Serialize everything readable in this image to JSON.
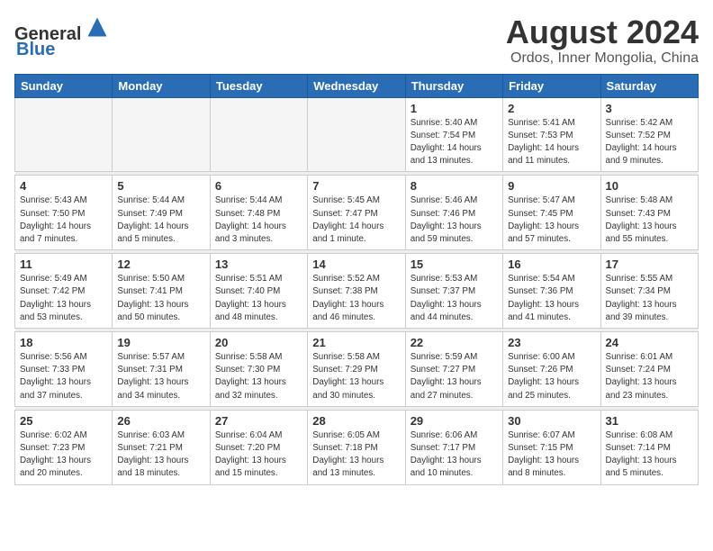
{
  "header": {
    "logo_general": "General",
    "logo_blue": "Blue",
    "month_title": "August 2024",
    "subtitle": "Ordos, Inner Mongolia, China"
  },
  "weekdays": [
    "Sunday",
    "Monday",
    "Tuesday",
    "Wednesday",
    "Thursday",
    "Friday",
    "Saturday"
  ],
  "weeks": [
    [
      {
        "day": "",
        "info": ""
      },
      {
        "day": "",
        "info": ""
      },
      {
        "day": "",
        "info": ""
      },
      {
        "day": "",
        "info": ""
      },
      {
        "day": "1",
        "info": "Sunrise: 5:40 AM\nSunset: 7:54 PM\nDaylight: 14 hours\nand 13 minutes."
      },
      {
        "day": "2",
        "info": "Sunrise: 5:41 AM\nSunset: 7:53 PM\nDaylight: 14 hours\nand 11 minutes."
      },
      {
        "day": "3",
        "info": "Sunrise: 5:42 AM\nSunset: 7:52 PM\nDaylight: 14 hours\nand 9 minutes."
      }
    ],
    [
      {
        "day": "4",
        "info": "Sunrise: 5:43 AM\nSunset: 7:50 PM\nDaylight: 14 hours\nand 7 minutes."
      },
      {
        "day": "5",
        "info": "Sunrise: 5:44 AM\nSunset: 7:49 PM\nDaylight: 14 hours\nand 5 minutes."
      },
      {
        "day": "6",
        "info": "Sunrise: 5:44 AM\nSunset: 7:48 PM\nDaylight: 14 hours\nand 3 minutes."
      },
      {
        "day": "7",
        "info": "Sunrise: 5:45 AM\nSunset: 7:47 PM\nDaylight: 14 hours\nand 1 minute."
      },
      {
        "day": "8",
        "info": "Sunrise: 5:46 AM\nSunset: 7:46 PM\nDaylight: 13 hours\nand 59 minutes."
      },
      {
        "day": "9",
        "info": "Sunrise: 5:47 AM\nSunset: 7:45 PM\nDaylight: 13 hours\nand 57 minutes."
      },
      {
        "day": "10",
        "info": "Sunrise: 5:48 AM\nSunset: 7:43 PM\nDaylight: 13 hours\nand 55 minutes."
      }
    ],
    [
      {
        "day": "11",
        "info": "Sunrise: 5:49 AM\nSunset: 7:42 PM\nDaylight: 13 hours\nand 53 minutes."
      },
      {
        "day": "12",
        "info": "Sunrise: 5:50 AM\nSunset: 7:41 PM\nDaylight: 13 hours\nand 50 minutes."
      },
      {
        "day": "13",
        "info": "Sunrise: 5:51 AM\nSunset: 7:40 PM\nDaylight: 13 hours\nand 48 minutes."
      },
      {
        "day": "14",
        "info": "Sunrise: 5:52 AM\nSunset: 7:38 PM\nDaylight: 13 hours\nand 46 minutes."
      },
      {
        "day": "15",
        "info": "Sunrise: 5:53 AM\nSunset: 7:37 PM\nDaylight: 13 hours\nand 44 minutes."
      },
      {
        "day": "16",
        "info": "Sunrise: 5:54 AM\nSunset: 7:36 PM\nDaylight: 13 hours\nand 41 minutes."
      },
      {
        "day": "17",
        "info": "Sunrise: 5:55 AM\nSunset: 7:34 PM\nDaylight: 13 hours\nand 39 minutes."
      }
    ],
    [
      {
        "day": "18",
        "info": "Sunrise: 5:56 AM\nSunset: 7:33 PM\nDaylight: 13 hours\nand 37 minutes."
      },
      {
        "day": "19",
        "info": "Sunrise: 5:57 AM\nSunset: 7:31 PM\nDaylight: 13 hours\nand 34 minutes."
      },
      {
        "day": "20",
        "info": "Sunrise: 5:58 AM\nSunset: 7:30 PM\nDaylight: 13 hours\nand 32 minutes."
      },
      {
        "day": "21",
        "info": "Sunrise: 5:58 AM\nSunset: 7:29 PM\nDaylight: 13 hours\nand 30 minutes."
      },
      {
        "day": "22",
        "info": "Sunrise: 5:59 AM\nSunset: 7:27 PM\nDaylight: 13 hours\nand 27 minutes."
      },
      {
        "day": "23",
        "info": "Sunrise: 6:00 AM\nSunset: 7:26 PM\nDaylight: 13 hours\nand 25 minutes."
      },
      {
        "day": "24",
        "info": "Sunrise: 6:01 AM\nSunset: 7:24 PM\nDaylight: 13 hours\nand 23 minutes."
      }
    ],
    [
      {
        "day": "25",
        "info": "Sunrise: 6:02 AM\nSunset: 7:23 PM\nDaylight: 13 hours\nand 20 minutes."
      },
      {
        "day": "26",
        "info": "Sunrise: 6:03 AM\nSunset: 7:21 PM\nDaylight: 13 hours\nand 18 minutes."
      },
      {
        "day": "27",
        "info": "Sunrise: 6:04 AM\nSunset: 7:20 PM\nDaylight: 13 hours\nand 15 minutes."
      },
      {
        "day": "28",
        "info": "Sunrise: 6:05 AM\nSunset: 7:18 PM\nDaylight: 13 hours\nand 13 minutes."
      },
      {
        "day": "29",
        "info": "Sunrise: 6:06 AM\nSunset: 7:17 PM\nDaylight: 13 hours\nand 10 minutes."
      },
      {
        "day": "30",
        "info": "Sunrise: 6:07 AM\nSunset: 7:15 PM\nDaylight: 13 hours\nand 8 minutes."
      },
      {
        "day": "31",
        "info": "Sunrise: 6:08 AM\nSunset: 7:14 PM\nDaylight: 13 hours\nand 5 minutes."
      }
    ]
  ]
}
